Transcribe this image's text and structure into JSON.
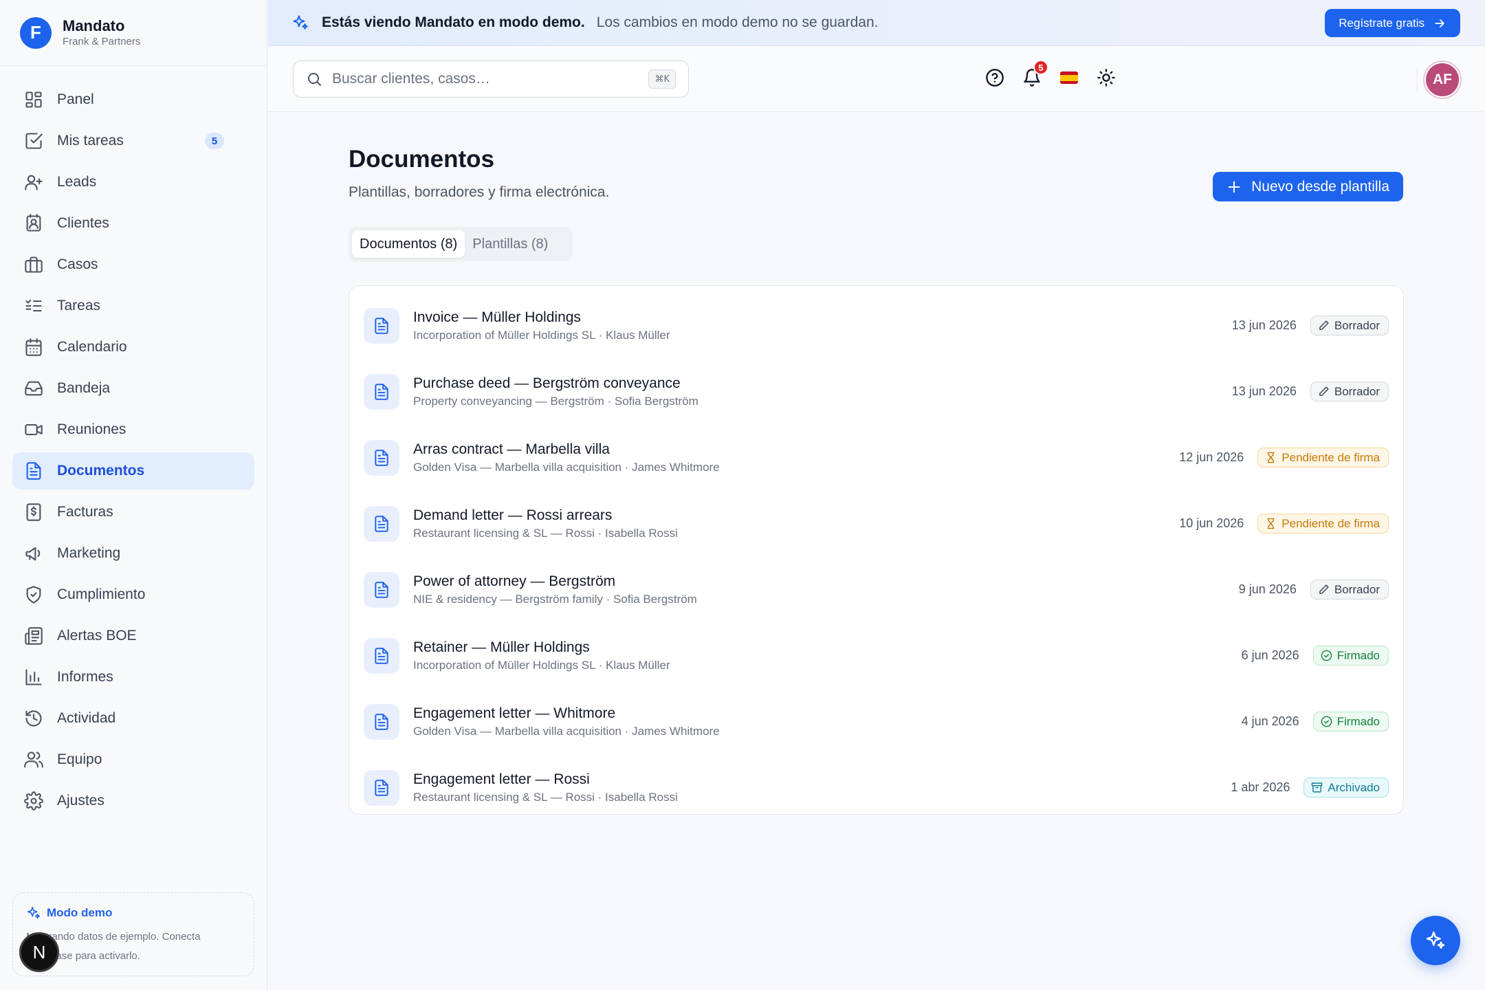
{
  "brand": {
    "logo_letter": "F",
    "name": "Mandato",
    "subtitle": "Frank & Partners"
  },
  "sidebar": {
    "items": [
      {
        "label": "Panel",
        "icon": "layout-grid-icon"
      },
      {
        "label": "Mis tareas",
        "icon": "square-check-icon",
        "badge": "5"
      },
      {
        "label": "Leads",
        "icon": "user-plus-icon"
      },
      {
        "label": "Clientes",
        "icon": "contact-icon"
      },
      {
        "label": "Casos",
        "icon": "briefcase-icon"
      },
      {
        "label": "Tareas",
        "icon": "list-checks-icon"
      },
      {
        "label": "Calendario",
        "icon": "calendar-icon"
      },
      {
        "label": "Bandeja",
        "icon": "inbox-icon"
      },
      {
        "label": "Reuniones",
        "icon": "video-icon"
      },
      {
        "label": "Documentos",
        "icon": "file-text-icon",
        "active": true
      },
      {
        "label": "Facturas",
        "icon": "receipt-icon"
      },
      {
        "label": "Marketing",
        "icon": "megaphone-icon"
      },
      {
        "label": "Cumplimiento",
        "icon": "shield-icon"
      },
      {
        "label": "Alertas BOE",
        "icon": "newspaper-icon"
      },
      {
        "label": "Informes",
        "icon": "bar-chart-icon"
      },
      {
        "label": "Actividad",
        "icon": "history-icon"
      },
      {
        "label": "Equipo",
        "icon": "users-icon"
      },
      {
        "label": "Ajustes",
        "icon": "gear-icon"
      }
    ],
    "demo": {
      "title": "Modo demo",
      "text": "Mostrando datos de ejemplo. Conecta Supabase para activarlo."
    },
    "dev_badge": "N"
  },
  "banner": {
    "strong": "Estás viendo Mandato en modo demo.",
    "text": "Los cambios en modo demo no se guardan.",
    "button": "Regístrate gratis"
  },
  "topbar": {
    "search_placeholder": "Buscar clientes, casos…",
    "shortcut": "⌘K",
    "notifications": "5",
    "language": "es",
    "avatar_initials": "AF"
  },
  "main": {
    "title": "Documentos",
    "subtitle": "Plantillas, borradores y firma electrónica.",
    "new_button": "Nuevo desde plantilla",
    "tabs": [
      {
        "label": "Documentos (8)",
        "active": true
      },
      {
        "label": "Plantillas (8)",
        "active": false
      }
    ],
    "documents": [
      {
        "title": "Invoice — Müller Holdings",
        "meta": "Incorporation of Müller Holdings SL · Klaus Müller",
        "date": "13 jun 2026",
        "status": "Borrador",
        "kind": "draft"
      },
      {
        "title": "Purchase deed — Bergström conveyance",
        "meta": "Property conveyancing — Bergström · Sofia Bergström",
        "date": "13 jun 2026",
        "status": "Borrador",
        "kind": "draft"
      },
      {
        "title": "Arras contract — Marbella villa",
        "meta": "Golden Visa — Marbella villa acquisition · James Whitmore",
        "date": "12 jun 2026",
        "status": "Pendiente de firma",
        "kind": "pending"
      },
      {
        "title": "Demand letter — Rossi arrears",
        "meta": "Restaurant licensing & SL — Rossi · Isabella Rossi",
        "date": "10 jun 2026",
        "status": "Pendiente de firma",
        "kind": "pending"
      },
      {
        "title": "Power of attorney — Bergström",
        "meta": "NIE & residency — Bergström family · Sofia Bergström",
        "date": "9 jun 2026",
        "status": "Borrador",
        "kind": "draft"
      },
      {
        "title": "Retainer — Müller Holdings",
        "meta": "Incorporation of Müller Holdings SL · Klaus Müller",
        "date": "6 jun 2026",
        "status": "Firmado",
        "kind": "signed"
      },
      {
        "title": "Engagement letter — Whitmore",
        "meta": "Golden Visa — Marbella villa acquisition · James Whitmore",
        "date": "4 jun 2026",
        "status": "Firmado",
        "kind": "signed"
      },
      {
        "title": "Engagement letter — Rossi",
        "meta": "Restaurant licensing & SL — Rossi · Isabella Rossi",
        "date": "1 abr 2026",
        "status": "Archivado",
        "kind": "archived"
      }
    ]
  },
  "colors": {
    "accent": "#1d63ed",
    "active_bg": "#e2edfd",
    "notif": "#e02424",
    "avatar": "#b94a7a"
  }
}
